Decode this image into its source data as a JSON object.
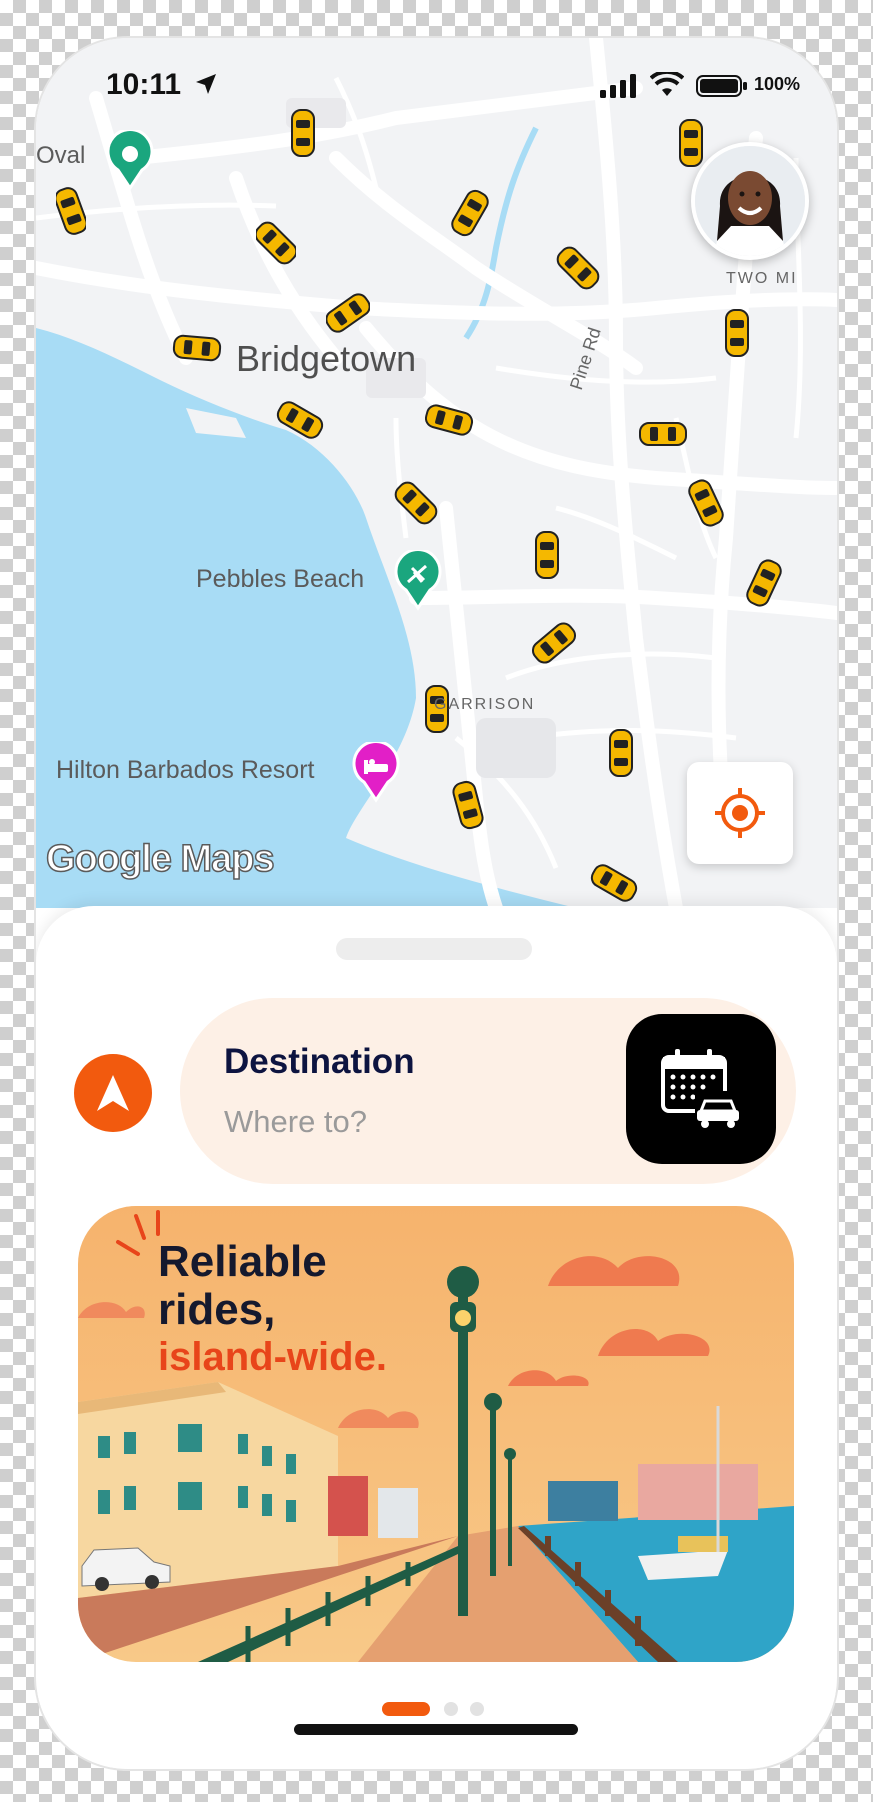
{
  "status_bar": {
    "time": "10:11",
    "battery": "100%"
  },
  "map": {
    "labels": {
      "city": "Bridgetown",
      "oval": "Oval",
      "pebbles": "Pebbles Beach",
      "hilton": "Hilton Barbados Resort",
      "garrison": "GARRISON",
      "two_mile": "TWO MI",
      "pine_rd": "Pine Rd"
    },
    "attribution": "Google Maps",
    "colors": {
      "water": "#a8dcf5",
      "land": "#f2f3f5",
      "road": "#ffffff",
      "taxi": "#f5b800",
      "pin_green": "#1aa67e",
      "pin_pink": "#e21fc7"
    }
  },
  "sheet": {
    "destination_title": "Destination",
    "destination_placeholder": "Where to?",
    "banner": {
      "line1": "Reliable",
      "line2": "rides,",
      "line3": "island-wide."
    },
    "pager": {
      "count": 3,
      "active": 1
    }
  },
  "colors": {
    "accent": "#f25a0e",
    "destination_bg": "#fdf0e6",
    "title": "#0d1440"
  }
}
